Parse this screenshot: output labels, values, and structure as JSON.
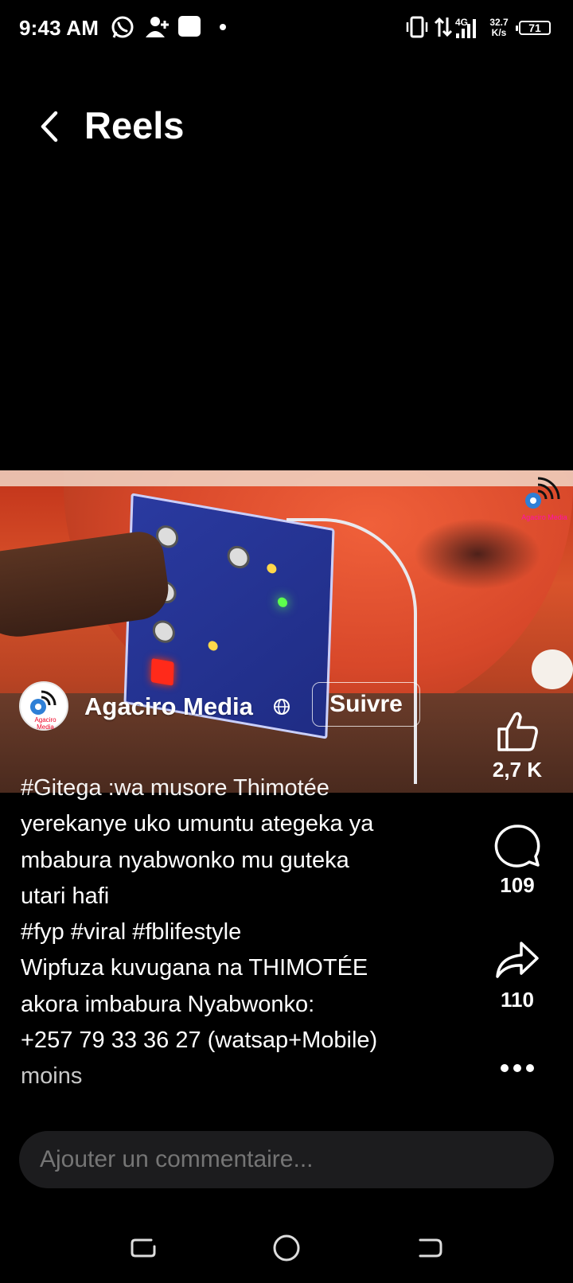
{
  "status_bar": {
    "time": "9:43 AM",
    "network": "4G",
    "speed_value": "32.7",
    "speed_unit": "K/s",
    "battery": "71",
    "icons": [
      "whatsapp-icon",
      "add-contact-icon",
      "square-notification-icon",
      "dot-icon",
      "vibrate-icon",
      "data-arrows-icon",
      "signal-icon"
    ]
  },
  "header": {
    "title": "Reels",
    "back_icon": "chevron-left-icon"
  },
  "video": {
    "watermark_text": "Agaciro Media"
  },
  "channel": {
    "name": "Agaciro Media",
    "avatar_text": "Agaciro Media",
    "follow_label": "Suivre",
    "privacy_icon": "globe-icon"
  },
  "actions": {
    "like_count": "2,7 K",
    "comment_count": "109",
    "share_count": "110",
    "more_icon": "more-horizontal-icon"
  },
  "caption": {
    "lines": [
      "#Gitega :wa musore Thimotée",
      "yerekanye uko umuntu ategeka ya",
      "mbabura nyabwonko mu guteka",
      "utari hafi",
      "#fyp #viral #fblifestyle",
      "Wipfuza kuvugana na THIMOTÉE",
      "akora imbabura Nyabwonko:",
      "+257 79 33 36 27 (watsap+Mobile)"
    ],
    "less_label": "moins"
  },
  "comment_box": {
    "placeholder": "Ajouter un commentaire..."
  },
  "nav": {
    "icons": [
      "recents-icon",
      "home-icon",
      "back-icon"
    ]
  },
  "colors": {
    "background": "#000000",
    "input_bg": "#1c1c1e",
    "placeholder": "#8c8c8c"
  }
}
